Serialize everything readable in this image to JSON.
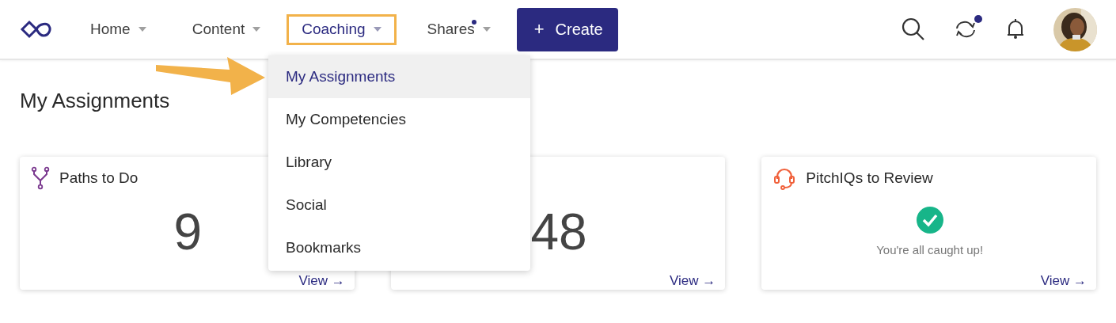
{
  "nav": {
    "items": [
      {
        "label": "Home",
        "selected": false,
        "dot": false
      },
      {
        "label": "Content",
        "selected": false,
        "dot": false
      },
      {
        "label": "Coaching",
        "selected": true,
        "dot": false
      },
      {
        "label": "Shares",
        "selected": false,
        "dot": true
      }
    ],
    "create_button": {
      "icon": "+",
      "label": "Create"
    },
    "sync_badge": true
  },
  "dropdown": {
    "items": [
      {
        "label": "My Assignments",
        "selected": true
      },
      {
        "label": "My Competencies",
        "selected": false
      },
      {
        "label": "Library",
        "selected": false
      },
      {
        "label": "Social",
        "selected": false
      },
      {
        "label": "Bookmarks",
        "selected": false
      }
    ]
  },
  "page_title": "My Assignments",
  "cards": [
    {
      "kind": "count",
      "title": "Paths to Do",
      "value": "9",
      "link": "View →"
    },
    {
      "kind": "count",
      "value": "48",
      "link": "View →"
    },
    {
      "kind": "status",
      "title": "PitchIQs to Review",
      "message": "You're all caught up!",
      "link": "View →"
    }
  ]
}
